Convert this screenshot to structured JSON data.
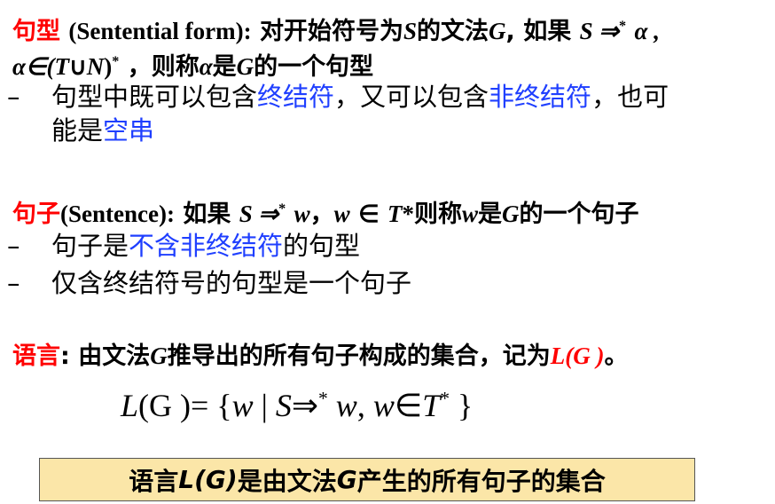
{
  "sentential": {
    "term": "句型",
    "eng": "(Sentential form):",
    "def_a": "对开始符号为",
    "S": "S",
    "def_b": "的文法",
    "G": "G",
    "def_c": ", 如果",
    "deriv": "S ⇒",
    "star": "*",
    "alpha": "α ,",
    "line2_a": "α∈(",
    "T": "T",
    "cup": "∪",
    "N": "N",
    "close": ")",
    "line2_b": "，则称",
    "alpha2": "α",
    "line2_c": "是",
    "G2": "G",
    "line2_d": "的一个句型",
    "bullet1_a": "句型中既可以包含",
    "bullet1_b": "终结符",
    "bullet1_c": "，又可以包含",
    "bullet1_d": "非终结符",
    "bullet1_e": "，也可",
    "bullet1_f": "能是",
    "bullet1_g": "空串"
  },
  "sentence": {
    "term": "句子",
    "eng": "(Sentence):",
    "if": "如果",
    "deriv": "S ⇒",
    "star": "*",
    "w": "w",
    "comma": "，",
    "w2": "w",
    "in": "∈",
    "T": "T",
    "tstar": "*",
    "then": "则称",
    "w3": "w",
    "is": "是",
    "G": "G",
    "tail": "的一个句子",
    "bullet1_a": "句子是",
    "bullet1_b": "不含非终结符",
    "bullet1_c": "的句型",
    "bullet2": "仅含终结符号的句型是一个句子"
  },
  "language": {
    "term": "语言",
    "colon": ":",
    "def_a": " 由文法",
    "G": "G",
    "def_b": "推导出的所有句子构成的集合，记为",
    "LG": "L(G )",
    "end": "。",
    "formula": {
      "L": "L",
      "G": "(G )= {",
      "w": "w",
      "bar": " | ",
      "S": "S",
      "arrow": "⇒",
      "star": "*",
      "w2": " w",
      "comma": ", ",
      "w3": "w",
      "in": "∈",
      "T": "T",
      "tstar": "*",
      "rbrace": " }"
    }
  },
  "summary": {
    "a": "语言",
    "L": "L(",
    "G": "G",
    "close": ")",
    "b": "是由文法",
    "G2": "G",
    "c": "产生的所有句子的集合"
  },
  "bullet_dash": "–",
  "colors": {
    "term": "#ff0000",
    "highlight": "#1f3fff",
    "box_fill": "#fbe6a8"
  }
}
